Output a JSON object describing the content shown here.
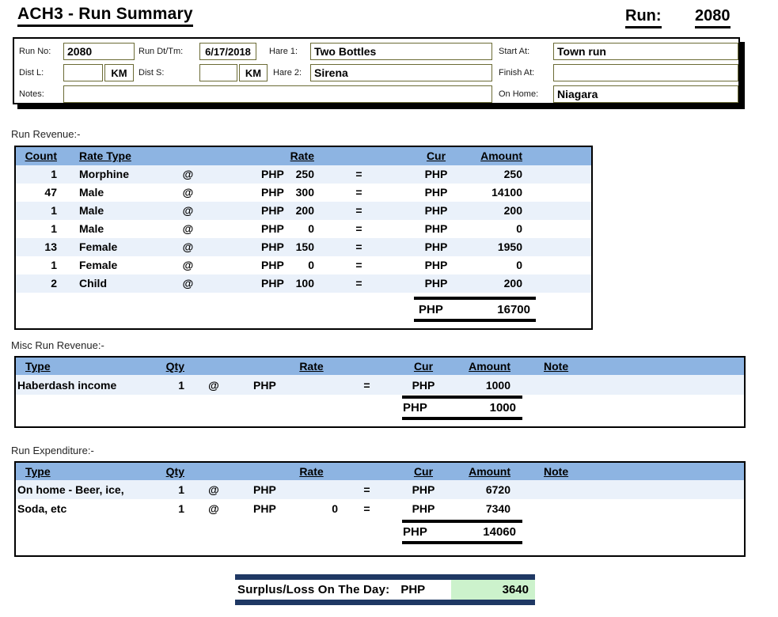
{
  "title": "ACH3 - Run Summary",
  "run": {
    "label": "Run:",
    "number": "2080"
  },
  "header": {
    "run_no_label": "Run No:",
    "run_no": "2080",
    "run_dt_label": "Run Dt/Tm:",
    "run_dt": "6/17/2018",
    "hare1_label": "Hare 1:",
    "hare1": "Two Bottles",
    "start_label": "Start At:",
    "start": "Town run",
    "dist_l_label": "Dist L:",
    "dist_l": "",
    "km": "KM",
    "dist_s_label": "Dist S:",
    "dist_s": "",
    "hare2_label": "Hare 2:",
    "hare2": "Sirena",
    "finish_label": "Finish At:",
    "finish": "",
    "notes_label": "Notes:",
    "notes": "",
    "on_home_label": "On Home:",
    "on_home": "Niagara"
  },
  "symbols": {
    "at": "@",
    "eq": "="
  },
  "revenue": {
    "section_label": "Run Revenue:-",
    "headers": {
      "count": "Count",
      "rate_type": "Rate Type",
      "rate": "Rate",
      "cur": "Cur",
      "amount": "Amount"
    },
    "rows": [
      {
        "count": "1",
        "type": "Morphine",
        "cur1": "PHP",
        "rate": "250",
        "cur2": "PHP",
        "amount": "250"
      },
      {
        "count": "47",
        "type": "Male",
        "cur1": "PHP",
        "rate": "300",
        "cur2": "PHP",
        "amount": "14100"
      },
      {
        "count": "1",
        "type": "Male",
        "cur1": "PHP",
        "rate": "200",
        "cur2": "PHP",
        "amount": "200"
      },
      {
        "count": "1",
        "type": "Male",
        "cur1": "PHP",
        "rate": "0",
        "cur2": "PHP",
        "amount": "0"
      },
      {
        "count": "13",
        "type": "Female",
        "cur1": "PHP",
        "rate": "150",
        "cur2": "PHP",
        "amount": "1950"
      },
      {
        "count": "1",
        "type": "Female",
        "cur1": "PHP",
        "rate": "0",
        "cur2": "PHP",
        "amount": "0"
      },
      {
        "count": "2",
        "type": "Child",
        "cur1": "PHP",
        "rate": "100",
        "cur2": "PHP",
        "amount": "200"
      }
    ],
    "total": {
      "cur": "PHP",
      "amount": "16700"
    }
  },
  "misc_revenue": {
    "section_label": "Misc Run Revenue:-",
    "headers": {
      "type": "Type",
      "qty": "Qty",
      "rate": "Rate",
      "cur": "Cur",
      "amount": "Amount",
      "note": "Note"
    },
    "rows": [
      {
        "type": "Haberdash income",
        "qty": "1",
        "cur1": "PHP",
        "rate": "",
        "cur2": "PHP",
        "amount": "1000",
        "note": ""
      }
    ],
    "total": {
      "cur": "PHP",
      "amount": "1000"
    }
  },
  "expenditure": {
    "section_label": "Run Expenditure:-",
    "headers": {
      "type": "Type",
      "qty": "Qty",
      "rate": "Rate",
      "cur": "Cur",
      "amount": "Amount",
      "note": "Note"
    },
    "rows": [
      {
        "type": "On home - Beer, ice,",
        "qty": "1",
        "cur1": "PHP",
        "rate": "",
        "cur2": "PHP",
        "amount": "6720",
        "note": ""
      },
      {
        "type": "Soda, etc",
        "qty": "1",
        "cur1": "PHP",
        "rate": "0",
        "cur2": "PHP",
        "amount": "7340",
        "note": ""
      }
    ],
    "total": {
      "cur": "PHP",
      "amount": "14060"
    }
  },
  "surplus": {
    "label": "Surplus/Loss On The Day:",
    "cur": "PHP",
    "amount": "3640"
  },
  "colors": {
    "header_blue": "#8DB4E2",
    "row_alt": "#EAF1FA",
    "navy": "#1F3864",
    "surplus_green": "#CCF2CC",
    "field_border": "#6B6B35"
  }
}
